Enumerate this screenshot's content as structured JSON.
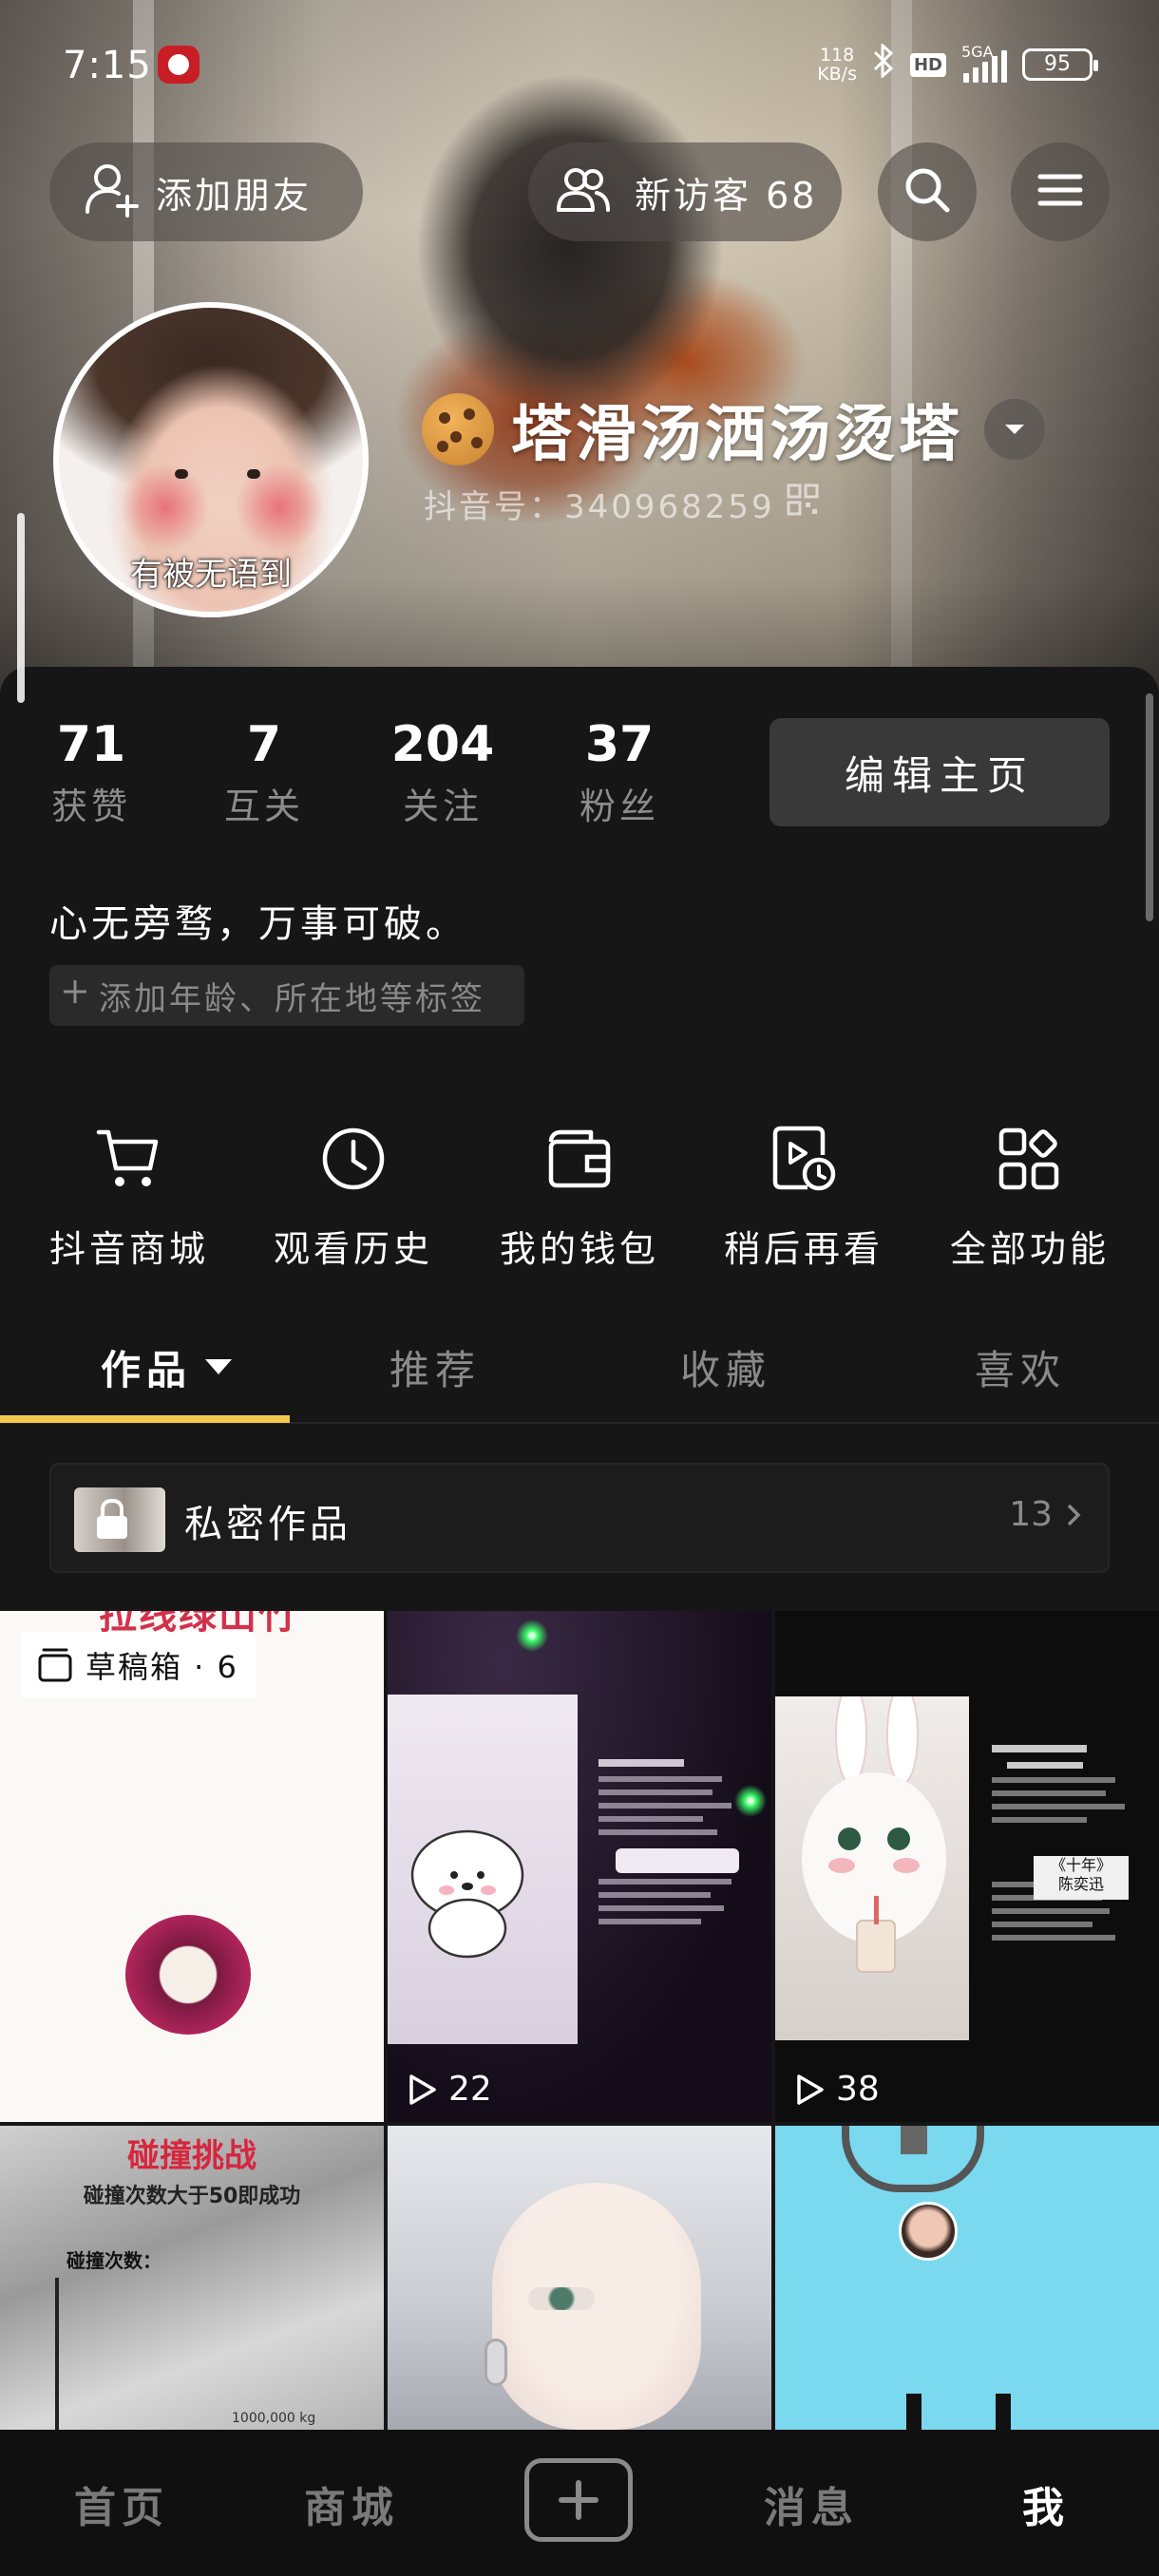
{
  "status_bar": {
    "time": "7:15",
    "net_speed_value": "118",
    "net_speed_unit": "KB/s",
    "hd_badge": "HD",
    "signal_label": "5GA",
    "battery": "95"
  },
  "header": {
    "add_friend_label": "添加朋友",
    "new_visitors_label": "新访客 68",
    "avatar_caption": "有被无语到",
    "nickname": "塔滑汤洒汤烫塔",
    "douyin_id": "抖音号：340968259"
  },
  "stats": [
    {
      "value": "71",
      "label": "获赞"
    },
    {
      "value": "7",
      "label": "互关"
    },
    {
      "value": "204",
      "label": "关注"
    },
    {
      "value": "37",
      "label": "粉丝"
    }
  ],
  "edit_profile_label": "编辑主页",
  "bio": "心无旁骛，万事可破。",
  "add_tags_label": "添加年龄、所在地等标签",
  "functions": [
    {
      "label": "抖音商城",
      "icon": "cart-icon"
    },
    {
      "label": "观看历史",
      "icon": "clock-icon"
    },
    {
      "label": "我的钱包",
      "icon": "wallet-icon"
    },
    {
      "label": "稍后再看",
      "icon": "watch-later-icon"
    },
    {
      "label": "全部功能",
      "icon": "grid-icon"
    }
  ],
  "tabs": [
    {
      "label": "作品",
      "active": true
    },
    {
      "label": "推荐",
      "active": false
    },
    {
      "label": "收藏",
      "active": false
    },
    {
      "label": "喜欢",
      "active": false
    }
  ],
  "private_works": {
    "label": "私密作品",
    "count": "13"
  },
  "grid": {
    "tile1": {
      "top_caption": "拉线绿山竹",
      "draft_label": "草稿箱 · 6"
    },
    "tile2": {
      "plays": "22"
    },
    "tile3": {
      "plays": "38",
      "label_line1": "《十年》",
      "label_line2": "陈奕迅"
    },
    "tile4": {
      "title": "碰撞挑战",
      "subtitle": "碰撞次数大于50即成功",
      "counter_label": "碰撞次数：",
      "weight": "1000,000 kg"
    }
  },
  "bottom_nav": [
    {
      "label": "首页",
      "active": false
    },
    {
      "label": "商城",
      "active": false
    },
    {
      "label": "消息",
      "active": false
    },
    {
      "label": "我",
      "active": true
    }
  ],
  "colors": {
    "accent_underline": "#f2c94c",
    "background": "#161616",
    "button_dark": "#393939"
  }
}
